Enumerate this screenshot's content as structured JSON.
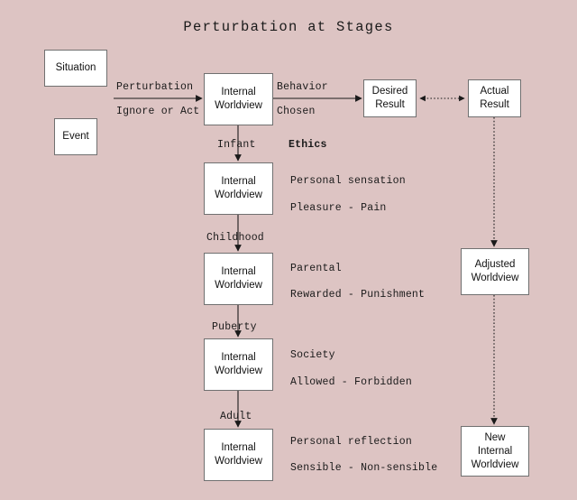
{
  "diagram": {
    "title": "Perturbation at Stages",
    "background_color": "#ddc4c3",
    "node_fill": "#ffffff",
    "node_border": "#707070",
    "line_color": "#1a1a1a"
  },
  "nodes": {
    "situation": {
      "label": "Situation"
    },
    "event": {
      "label": "Event"
    },
    "worldview_top": {
      "line1": "Internal",
      "line2": "Worldview"
    },
    "worldview_infant": {
      "line1": "Internal",
      "line2": "Worldview"
    },
    "worldview_childhood": {
      "line1": "Internal",
      "line2": "Worldview"
    },
    "worldview_puberty": {
      "line1": "Internal",
      "line2": "Worldview"
    },
    "worldview_adult": {
      "line1": "Internal",
      "line2": "Worldview"
    },
    "desired_result": {
      "line1": "Desired",
      "line2": "Result"
    },
    "actual_result": {
      "line1": "Actual",
      "line2": "Result"
    },
    "adjusted_worldview": {
      "line1": "Adjusted",
      "line2": "Worldview"
    },
    "new_internal_worldview": {
      "line1": "New",
      "line2": "Internal",
      "line3": "Worldview"
    }
  },
  "edge_labels": {
    "perturbation": "Perturbation",
    "ignore_or_act": "Ignore or Act",
    "behavior": "Behavior",
    "chosen": "Chosen",
    "infant": "Infant",
    "childhood": "Childhood",
    "puberty": "Puberty",
    "adult": "Adult"
  },
  "annotations": {
    "ethics_heading": "Ethics",
    "stages": [
      {
        "source": "Personal sensation",
        "polarity": "Pleasure - Pain"
      },
      {
        "source": "Parental",
        "polarity": "Rewarded - Punishment"
      },
      {
        "source": "Society",
        "polarity": "Allowed - Forbidden"
      },
      {
        "source": "Personal reflection",
        "polarity": "Sensible - Non-sensible"
      }
    ]
  }
}
